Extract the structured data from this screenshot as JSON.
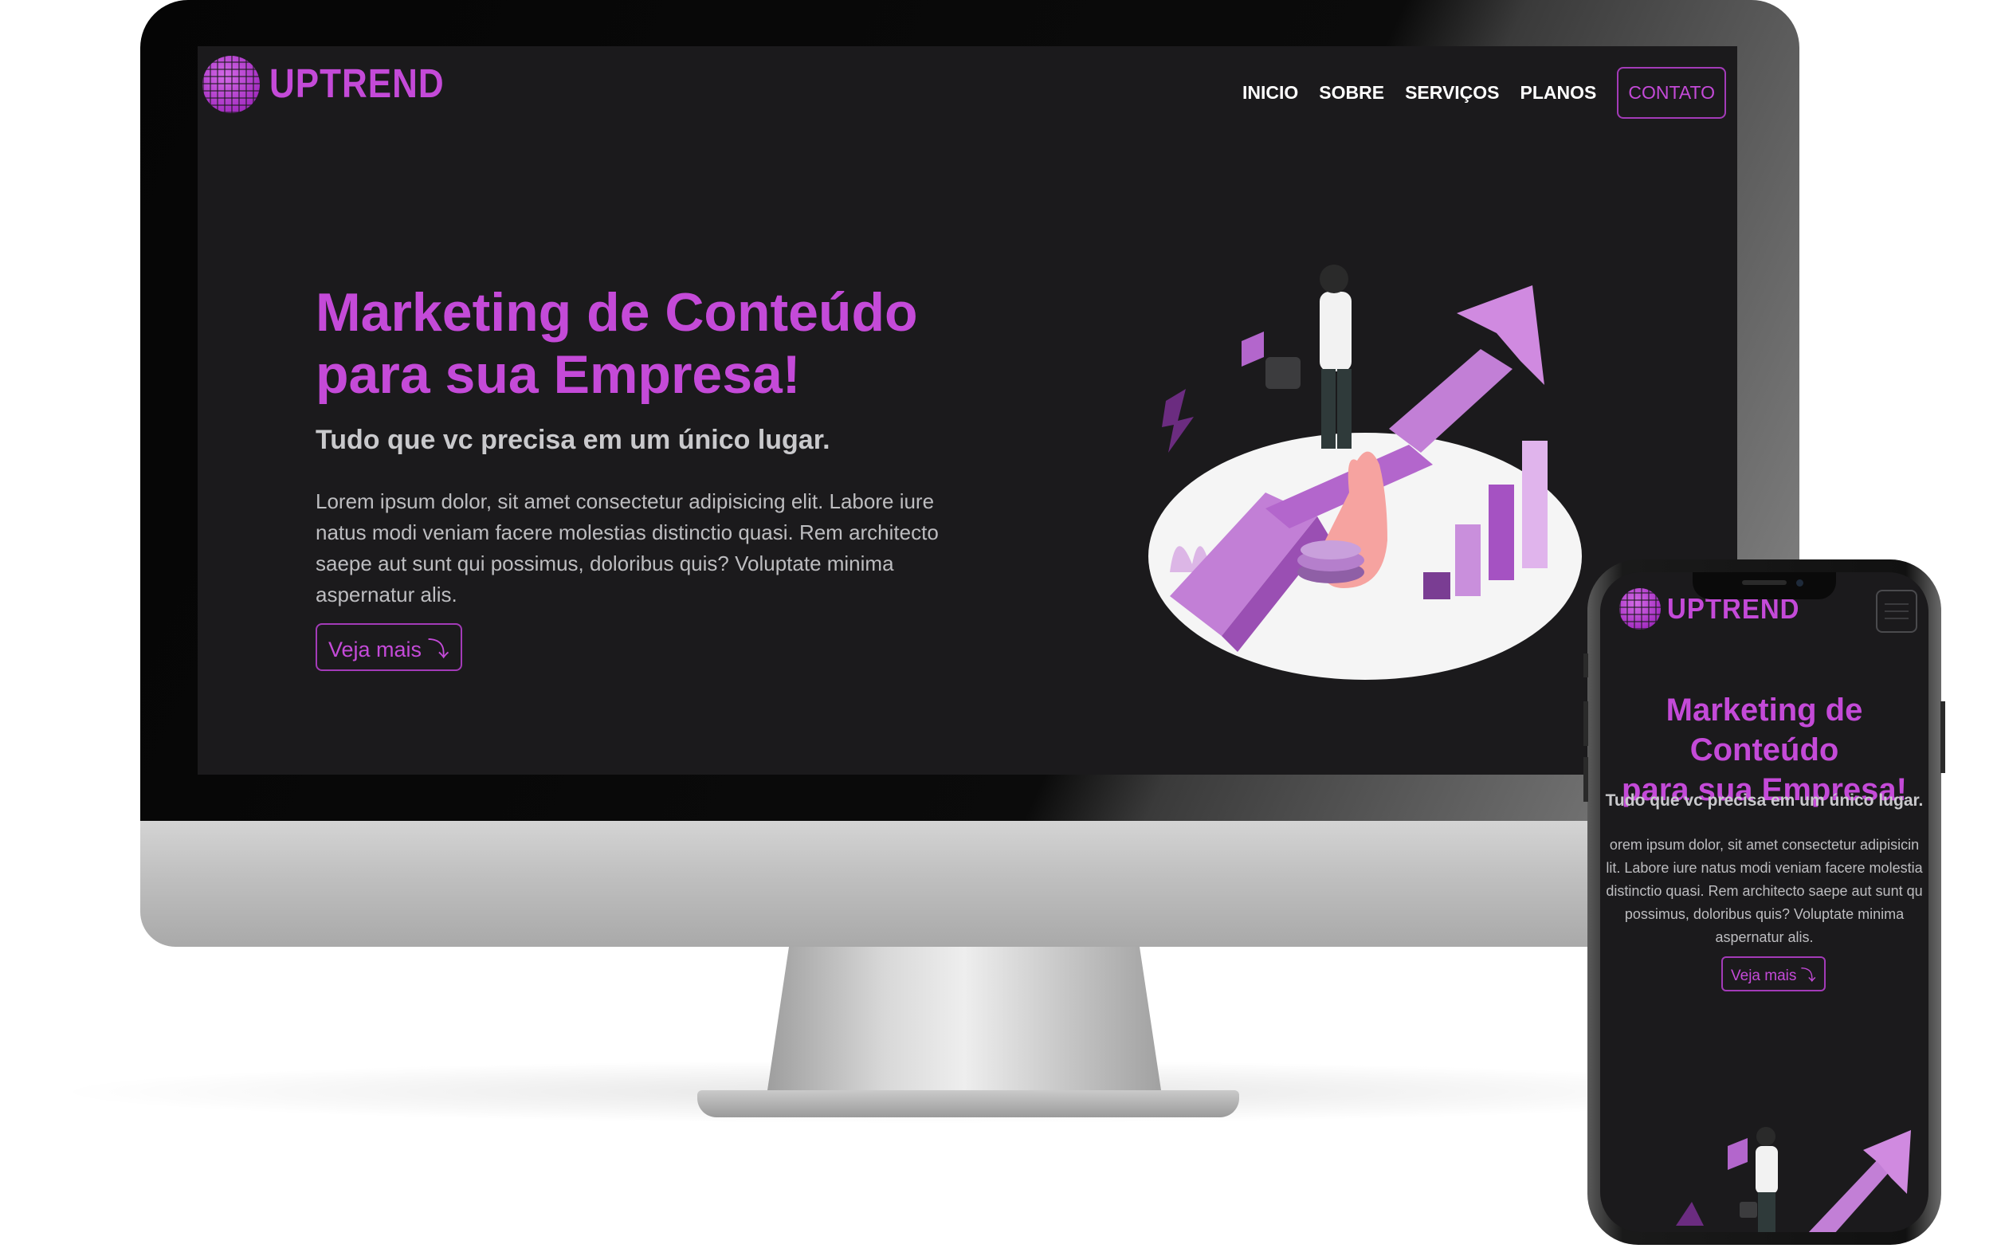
{
  "brand": {
    "name": "UPTREND"
  },
  "nav": {
    "items": [
      "INICIO",
      "SOBRE",
      "SERVIÇOS",
      "PLANOS"
    ],
    "contact": "CONTATO"
  },
  "hero": {
    "title_line1": "Marketing de Conteúdo",
    "title_line2": "para sua Empresa!",
    "subtitle": "Tudo que vc precisa em um único lugar.",
    "body": "Lorem ipsum dolor, sit amet consectetur adipisicing elit. Labore iure natus modi veniam facere molestias distinctio quasi. Rem architecto saepe aut sunt qui possimus, doloribus quis? Voluptate minima aspernatur alis.",
    "cta": "Veja mais ⤵"
  },
  "mobile": {
    "body_lines": [
      "orem ipsum dolor, sit amet consectetur adipisicin",
      "lit. Labore iure natus modi veniam facere molestia",
      "distinctio quasi. Rem architecto saepe aut sunt qu",
      "possimus, doloribus quis? Voluptate minima",
      "aspernatur alis."
    ]
  },
  "colors": {
    "accent": "#c44ad8",
    "background": "#1b1a1c",
    "text_light": "#bdbdc0"
  },
  "icons": [
    "globe-logo-icon",
    "hamburger-menu-icon",
    "growth-arrow-illustration"
  ]
}
